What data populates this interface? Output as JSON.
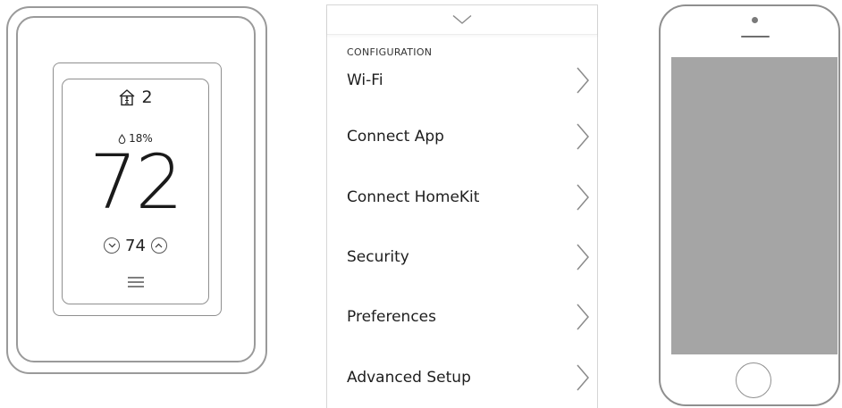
{
  "thermostat": {
    "occupancy_count": "2",
    "humidity": "18%",
    "current_temperature": "72",
    "setpoint": "74",
    "icons": [
      "home-person-icon",
      "droplet-icon",
      "chevron-down-circle-icon",
      "chevron-up-circle-icon",
      "hamburger-menu-icon"
    ]
  },
  "menu": {
    "collapse_icon": "chevron-down-icon",
    "section_label": "CONFIGURATION",
    "items": [
      {
        "label": "Wi-Fi"
      },
      {
        "label": "Connect App"
      },
      {
        "label": "Connect HomeKit"
      },
      {
        "label": "Security"
      },
      {
        "label": "Preferences"
      },
      {
        "label": "Advanced Setup"
      }
    ],
    "item_icon": "chevron-right-icon"
  },
  "phone": {
    "screen_color": "#a5a5a5"
  },
  "colors": {
    "outline": "#9a9a9a",
    "text": "#222222"
  }
}
